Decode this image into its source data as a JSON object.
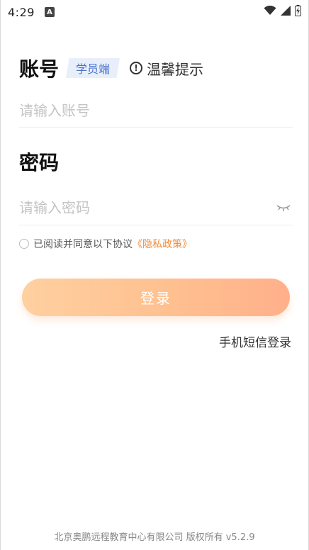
{
  "status_bar": {
    "time": "4:29",
    "notification_icon": "A"
  },
  "account": {
    "title": "账号",
    "role_badge": "学员端",
    "tip_label": "温馨提示",
    "placeholder": "请输入账号",
    "value": ""
  },
  "password": {
    "title": "密码",
    "placeholder": "请输入密码",
    "value": ""
  },
  "agreement": {
    "text": "已阅读并同意以下协议",
    "policy_link": "《隐私政策》",
    "checked": false
  },
  "login_button": {
    "label": "登录"
  },
  "sms_login": {
    "label": "手机短信登录"
  },
  "footer": {
    "text": "北京奥鹏远程教育中心有限公司 版权所有 v5.2.9"
  },
  "colors": {
    "accent": "#f08a3c",
    "badge_bg": "#e8effb",
    "badge_text": "#4a72c8",
    "button_gradient_start": "#ffd0a0",
    "button_gradient_end": "#ffb08a"
  }
}
